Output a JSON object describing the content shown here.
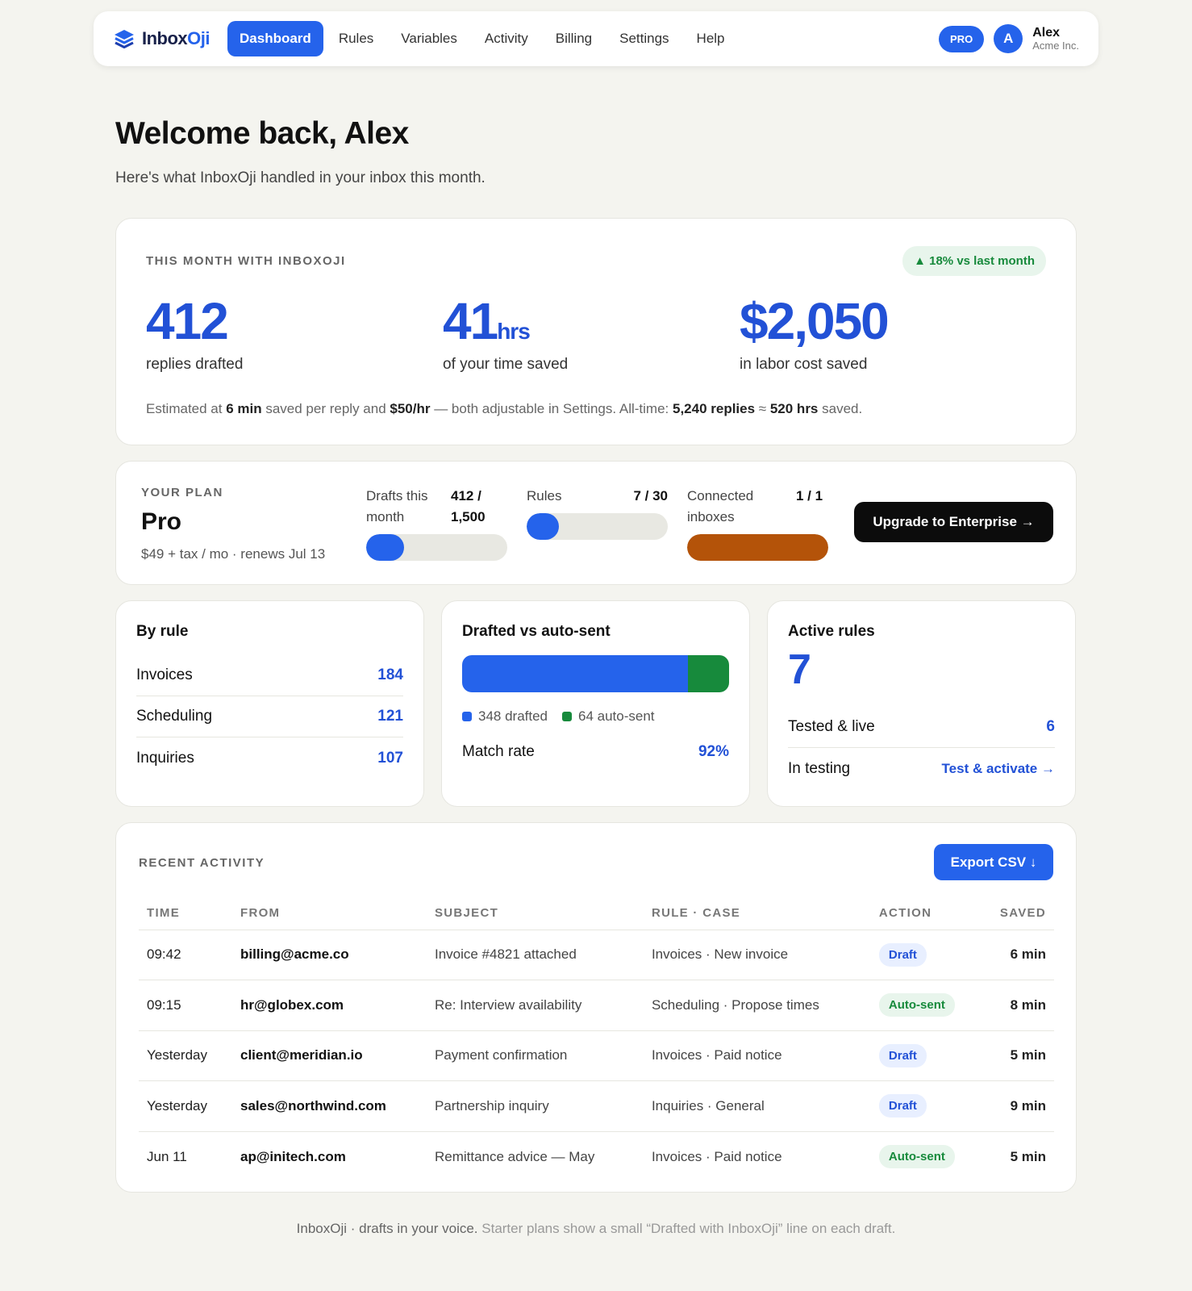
{
  "nav": {
    "brand_a": "Inbox",
    "brand_b": "Oji",
    "links": [
      "Dashboard",
      "Rules",
      "Variables",
      "Activity",
      "Billing",
      "Settings",
      "Help"
    ],
    "plan_badge": "PRO",
    "avatar_initial": "A",
    "user_name": "Alex",
    "user_org": "Acme Inc."
  },
  "welcome": {
    "title": "Welcome back, Alex",
    "subtitle": "Here's what InboxOji handled in your inbox this month."
  },
  "month": {
    "label": "This month with InboxOji",
    "trend": "▲ 18% vs last month",
    "stats": [
      {
        "value": "412",
        "unit": "",
        "caption": "replies drafted"
      },
      {
        "value": "41",
        "unit": "hrs",
        "caption": "of your time saved"
      },
      {
        "value": "$2,050",
        "unit": "",
        "caption": "in labor cost saved"
      }
    ],
    "note": {
      "p1": "Estimated at ",
      "b1": "6 min",
      "p2": " saved per reply and ",
      "b2": "$50/hr",
      "p3": " — both adjustable in Settings. All-time: ",
      "b3": "5,240 replies",
      "p4": " ≈ ",
      "b4": "520 hrs",
      "p5": " saved."
    }
  },
  "plan": {
    "label": "Your plan",
    "name": "Pro",
    "price": "$49 + tax / mo · renews Jul 13",
    "meters": [
      {
        "title": "Drafts this month",
        "value": "412 / 1,500",
        "fraction": 0.27,
        "color": "#2563eb"
      },
      {
        "title": "Rules",
        "value": "7 / 30",
        "fraction": 0.23,
        "color": "#2563eb"
      },
      {
        "title": "Connected inboxes",
        "value": "1 / 1",
        "fraction": 1.0,
        "color": "#b45309"
      }
    ],
    "upgrade_label": "Upgrade to Enterprise →"
  },
  "by_rule": {
    "title": "By rule",
    "rows": [
      {
        "name": "Invoices",
        "count": "184"
      },
      {
        "name": "Scheduling",
        "count": "121"
      },
      {
        "name": "Inquiries",
        "count": "107"
      }
    ]
  },
  "drafted_vs_auto": {
    "title": "Drafted vs auto-sent",
    "drafted_count": 348,
    "auto_count": 64,
    "drafted_label": "348 drafted",
    "auto_label": "64 auto-sent",
    "drafted_color": "#2563eb",
    "auto_color": "#178a3c",
    "match_label": "Match rate",
    "match_value": "92%"
  },
  "active_rules": {
    "title": "Active rules",
    "count": "7",
    "live_label": "Tested & live",
    "live_value": "6",
    "testing_label": "In testing",
    "testing_link": "Test & activate →"
  },
  "activity": {
    "label": "Recent activity",
    "export_label": "Export CSV ↓",
    "columns": [
      "Time",
      "From",
      "Subject",
      "Rule · Case",
      "Action",
      "Saved"
    ],
    "rows": [
      {
        "time": "09:42",
        "from": "billing@acme.co",
        "subject": "Invoice #4821 attached",
        "rule": "Invoices · New invoice",
        "action": "Draft",
        "saved": "6 min"
      },
      {
        "time": "09:15",
        "from": "hr@globex.com",
        "subject": "Re: Interview availability",
        "rule": "Scheduling · Propose times",
        "action": "Auto-sent",
        "saved": "8 min"
      },
      {
        "time": "Yesterday",
        "from": "client@meridian.io",
        "subject": "Payment confirmation",
        "rule": "Invoices · Paid notice",
        "action": "Draft",
        "saved": "5 min"
      },
      {
        "time": "Yesterday",
        "from": "sales@northwind.com",
        "subject": "Partnership inquiry",
        "rule": "Inquiries · General",
        "action": "Draft",
        "saved": "9 min"
      },
      {
        "time": "Jun 11",
        "from": "ap@initech.com",
        "subject": "Remittance advice — May",
        "rule": "Invoices · Paid notice",
        "action": "Auto-sent",
        "saved": "5 min"
      }
    ]
  },
  "footer": {
    "strong": "InboxOji · drafts in your voice.",
    "rest": " Starter plans show a small “Drafted with InboxOji” line on each draft."
  },
  "colors": {
    "accent": "#2563eb",
    "success": "#178a3c",
    "warning": "#b45309"
  }
}
